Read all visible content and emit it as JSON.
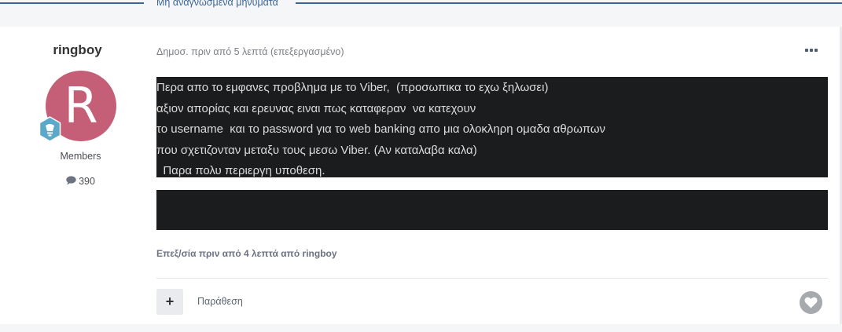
{
  "unread": {
    "label": "Μη αναγνωσμένα μηνύματα"
  },
  "author": {
    "name": "ringboy",
    "avatar_letter": "R",
    "avatar_color": "#c45f77",
    "group": "Members",
    "post_count": "390"
  },
  "post": {
    "meta": "Δημοσ. πριν από 5 λεπτά (επεξεργασμένο)",
    "spoiler_lines": [
      "Περα απο το εμφανες προβλημα με το Viber,  (προσωπικα το εχω ξηλωσει)",
      "αξιον απορίας και ερευνας ειναι πως καταφεραν  να κατεχουν",
      "το username  και το password για το web banking απο μια ολοκληρη ομαδα αθρωπων",
      "που σχετιζονταν μεταξυ τους μεσω Viber. (Αν καταλαβα καλα)",
      "  Παρα πολυ περιεργη υποθεση."
    ],
    "edited_note": "Επεξ/σία πριν από 4 λεπτά από ringboy",
    "quote_label": "Παράθεση",
    "plus_label": "+"
  },
  "icons": {
    "more": "more-options-icon",
    "rank": "rank-badge-icon",
    "comment": "comment-bubble-icon",
    "like": "heart-icon"
  },
  "colors": {
    "accent": "#3d6594",
    "spoiler_bg": "#1b1c1e",
    "rank_badge": "#5aa9c9"
  }
}
